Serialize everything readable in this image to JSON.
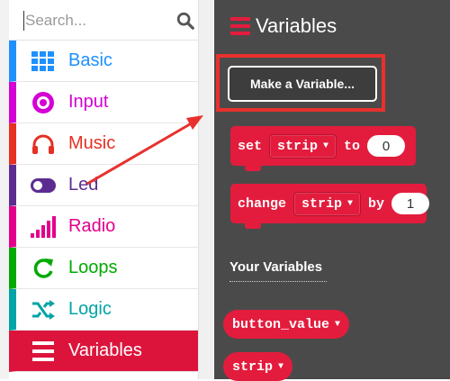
{
  "search": {
    "placeholder": "Search..."
  },
  "categories": [
    {
      "label": "Basic",
      "color": "#1e90ff",
      "icon": "grid-icon"
    },
    {
      "label": "Input",
      "color": "#d400d4",
      "icon": "radio-button-icon"
    },
    {
      "label": "Music",
      "color": "#e63022",
      "icon": "headphones-icon"
    },
    {
      "label": "Led",
      "color": "#5c2d91",
      "icon": "toggle-icon"
    },
    {
      "label": "Radio",
      "color": "#e3008c",
      "icon": "signal-bars-icon"
    },
    {
      "label": "Loops",
      "color": "#00aa00",
      "icon": "refresh-icon"
    },
    {
      "label": "Logic",
      "color": "#00a4a6",
      "icon": "shuffle-icon"
    },
    {
      "label": "Variables",
      "color": "#dc143c",
      "icon": "list-icon",
      "selected": true
    }
  ],
  "flyout": {
    "title": "Variables",
    "make_variable_label": "Make a Variable...",
    "set_block": {
      "keyword": "set",
      "variable": "strip",
      "to_label": "to",
      "value": "0"
    },
    "change_block": {
      "keyword": "change",
      "variable": "strip",
      "by_label": "by",
      "value": "1"
    },
    "your_variables_heading": "Your Variables",
    "variables": [
      "button_value",
      "strip"
    ]
  },
  "colors": {
    "block": "#e31c3d",
    "flyout_bg": "#4a4a4a",
    "highlight": "#e8312e"
  }
}
